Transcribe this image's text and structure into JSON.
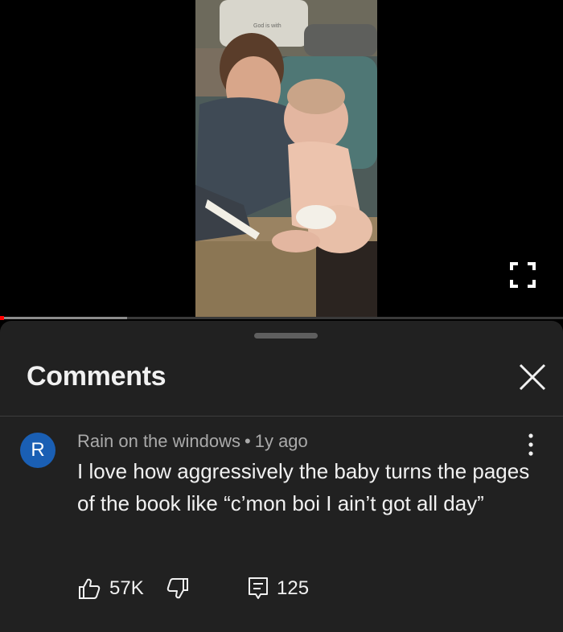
{
  "player": {
    "progress_fraction": 0.225,
    "fullscreen_icon": "fullscreen-icon",
    "pillow_text": "God is with"
  },
  "comments_panel": {
    "title": "Comments",
    "close_icon": "close-icon"
  },
  "comment": {
    "avatar_letter": "R",
    "avatar_color": "#1a5fb4",
    "author": "Rain on the windows",
    "separator": "•",
    "age": "1y ago",
    "text": "I love how aggressively the baby turns the pages of the book like “c’mon boi I ain’t got all day”",
    "like_count": "57K",
    "reply_count": "125",
    "like_icon": "thumbs-up-icon",
    "dislike_icon": "thumbs-down-icon",
    "reply_icon": "reply-icon",
    "more_icon": "more-vertical-icon"
  },
  "colors": {
    "sheet_bg": "#212121",
    "text_primary": "#f1f1f1",
    "text_secondary": "#aaaaaa",
    "progress_accent": "#ff0000"
  }
}
